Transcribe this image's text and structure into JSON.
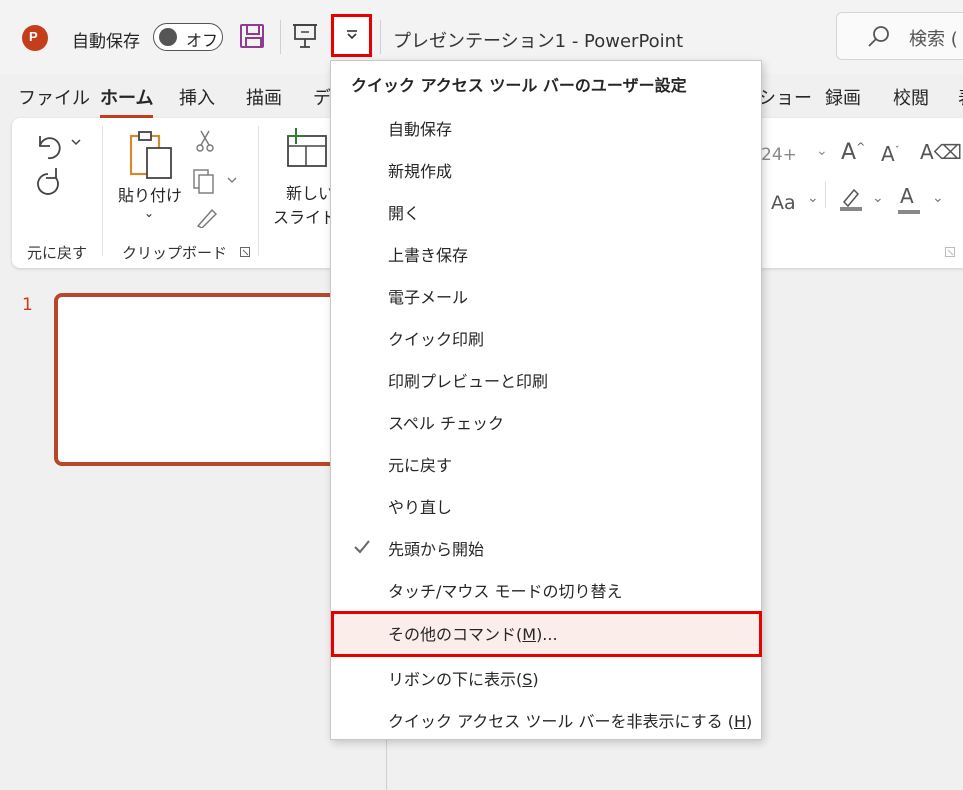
{
  "colors": {
    "accent": "#c43e1c",
    "highlight_border": "#e60000",
    "menu_hover": "#fbeeea"
  },
  "titlebar": {
    "app_icon": "powerpoint-icon",
    "autosave_label": "自動保存",
    "autosave_toggle": "オフ",
    "doc_title": "プレゼンテーション1  -  PowerPoint",
    "search_label": "検索 ("
  },
  "tabs": [
    {
      "label": "ファイル",
      "active": false
    },
    {
      "label": "ホーム",
      "active": true
    },
    {
      "label": "挿入",
      "active": false
    },
    {
      "label": "描画",
      "active": false
    },
    {
      "label": "デ",
      "active": false
    },
    {
      "label": "ショー",
      "active": false
    },
    {
      "label": "録画",
      "active": false
    },
    {
      "label": "校閲",
      "active": false
    },
    {
      "label": "表",
      "active": false
    }
  ],
  "ribbon": {
    "undo_group": "元に戻す",
    "clipboard_group": "クリップボード",
    "paste_label": "貼り付け",
    "new_slide_line1": "新しい",
    "new_slide_line2": "スライド",
    "font_size": "24+",
    "font_aa": "Aa"
  },
  "slides": {
    "number": "1"
  },
  "menu": {
    "title": "クイック アクセス ツール バーのユーザー設定",
    "items": [
      {
        "label": "自動保存",
        "checked": false
      },
      {
        "label": "新規作成",
        "checked": false
      },
      {
        "label": "開く",
        "checked": false
      },
      {
        "label": "上書き保存",
        "checked": false
      },
      {
        "label": "電子メール",
        "checked": false
      },
      {
        "label": "クイック印刷",
        "checked": false
      },
      {
        "label": "印刷プレビューと印刷",
        "checked": false
      },
      {
        "label": "スペル チェック",
        "checked": false
      },
      {
        "label": "元に戻す",
        "checked": false
      },
      {
        "label": "やり直し",
        "checked": false
      },
      {
        "label": "先頭から開始",
        "checked": true
      },
      {
        "label": "タッチ/マウス モードの切り替え",
        "checked": false
      }
    ],
    "more_commands_pre": "その他のコマンド(",
    "more_commands_key": "M",
    "more_commands_post": ")...",
    "below_ribbon_pre": "リボンの下に表示(",
    "below_ribbon_key": "S",
    "below_ribbon_post": ")",
    "hide_pre": "クイック アクセス ツール バーを非表示にする (",
    "hide_key": "H",
    "hide_post": ")"
  }
}
